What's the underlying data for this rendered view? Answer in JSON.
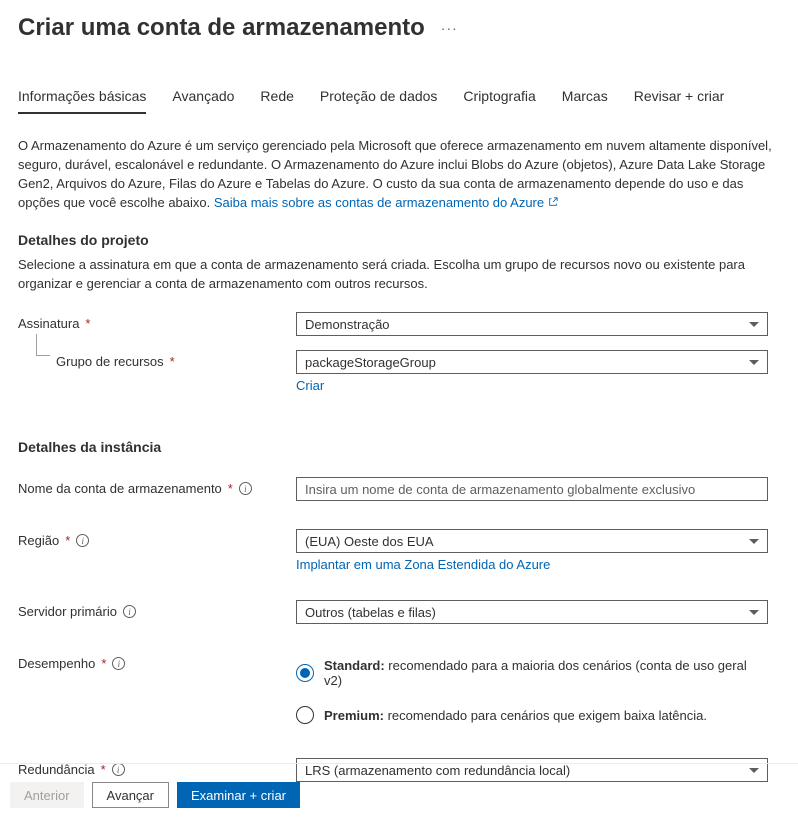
{
  "header": {
    "title": "Criar uma conta de armazenamento"
  },
  "tabs": [
    {
      "label": "Informações básicas",
      "active": true
    },
    {
      "label": "Avançado"
    },
    {
      "label": "Rede"
    },
    {
      "label": "Proteção de dados"
    },
    {
      "label": "Criptografia"
    },
    {
      "label": "Marcas"
    },
    {
      "label": "Revisar + criar"
    }
  ],
  "intro": {
    "text": "O Armazenamento do Azure é um serviço gerenciado pela Microsoft que oferece armazenamento em nuvem altamente disponível, seguro, durável, escalonável e redundante. O Armazenamento do Azure inclui Blobs do Azure (objetos), Azure Data Lake Storage Gen2, Arquivos do Azure, Filas do Azure e Tabelas do Azure. O custo da sua conta de armazenamento depende do uso e das opções que você escolhe abaixo. ",
    "link": "Saiba mais sobre as contas de armazenamento do Azure"
  },
  "projectDetails": {
    "title": "Detalhes do projeto",
    "desc": "Selecione a assinatura em que a conta de armazenamento será criada. Escolha um grupo de recursos novo ou existente para organizar e gerenciar a conta de armazenamento com outros recursos.",
    "subscription": {
      "label": "Assinatura",
      "value": "Demonstração"
    },
    "resourceGroup": {
      "label": "Grupo de recursos",
      "value": "packageStorageGroup",
      "createLink": "Criar"
    }
  },
  "instanceDetails": {
    "title": "Detalhes da instância",
    "storageName": {
      "label": "Nome da conta de armazenamento",
      "placeholder": "Insira um nome de conta de armazenamento globalmente exclusivo"
    },
    "region": {
      "label": "Região",
      "value": "(EUA) Oeste dos EUA",
      "extendedLink": "Implantar em uma Zona Estendida do Azure"
    },
    "primaryService": {
      "label": "Servidor primário",
      "value": "Outros (tabelas e filas)"
    },
    "performance": {
      "label": "Desempenho",
      "standard": {
        "bold": "Standard:",
        "text": " recomendado para a maioria dos cenários (conta de uso geral v2)"
      },
      "premium": {
        "bold": "Premium:",
        "text": " recomendado para cenários que exigem baixa latência."
      }
    },
    "redundancy": {
      "label": "Redundância",
      "value": "LRS (armazenamento com redundância local)"
    }
  },
  "footer": {
    "prev": "Anterior",
    "next": "Avançar",
    "review": "Examinar + criar"
  }
}
